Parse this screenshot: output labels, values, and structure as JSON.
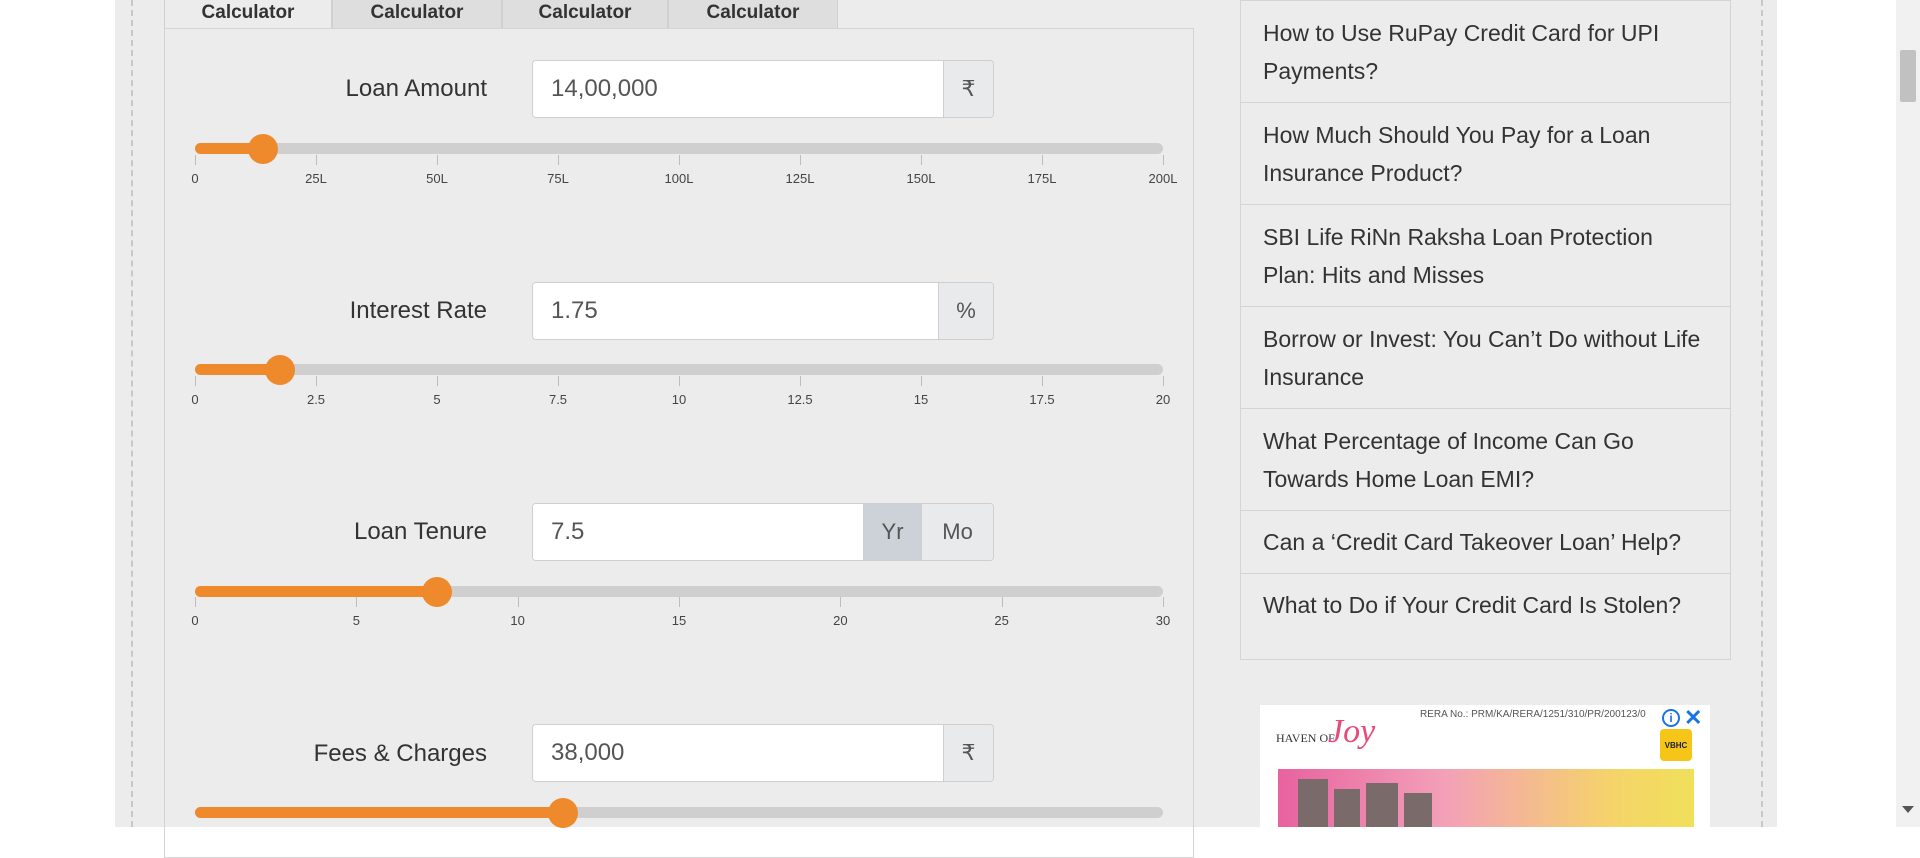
{
  "tabs": [
    "Calculator",
    "Calculator",
    "Calculator",
    "Calculator"
  ],
  "loan_amount": {
    "label": "Loan Amount",
    "value": "14,00,000",
    "unit": "₹",
    "slider_fraction": 0.07,
    "ticks": [
      "0",
      "25L",
      "50L",
      "75L",
      "100L",
      "125L",
      "150L",
      "175L",
      "200L"
    ]
  },
  "interest_rate": {
    "label": "Interest Rate",
    "value": "1.75",
    "unit": "%",
    "slider_fraction": 0.0875,
    "ticks": [
      "0",
      "2.5",
      "5",
      "7.5",
      "10",
      "12.5",
      "15",
      "17.5",
      "20"
    ]
  },
  "loan_tenure": {
    "label": "Loan Tenure",
    "value": "7.5",
    "unit_year": "Yr",
    "unit_month": "Mo",
    "selected_unit": "Yr",
    "slider_fraction": 0.25,
    "ticks": [
      "0",
      "5",
      "10",
      "15",
      "20",
      "25",
      "30"
    ]
  },
  "fees_charges": {
    "label": "Fees & Charges",
    "value": "38,000",
    "unit": "₹",
    "slider_fraction": 0.38
  },
  "sidebar": {
    "items": [
      "How to Use RuPay Credit Card for UPI Payments?",
      "How Much Should You Pay for a Loan Insurance Product?",
      "SBI Life RiNn Raksha Loan Protection Plan: Hits and Misses",
      "Borrow or Invest: You Can’t Do without Life Insurance",
      "What Percentage of Income Can Go Towards Home Loan EMI?",
      "Can a ‘Credit Card Takeover Loan’ Help?",
      "What to Do if Your Credit Card Is Stolen?"
    ]
  },
  "ad": {
    "rera_text": "RERA No.: PRM/KA/RERA/1251/310/PR/200123/0",
    "brand_small": "HAVEN OF",
    "brand_script": "Joy",
    "badge": "VBHC"
  }
}
